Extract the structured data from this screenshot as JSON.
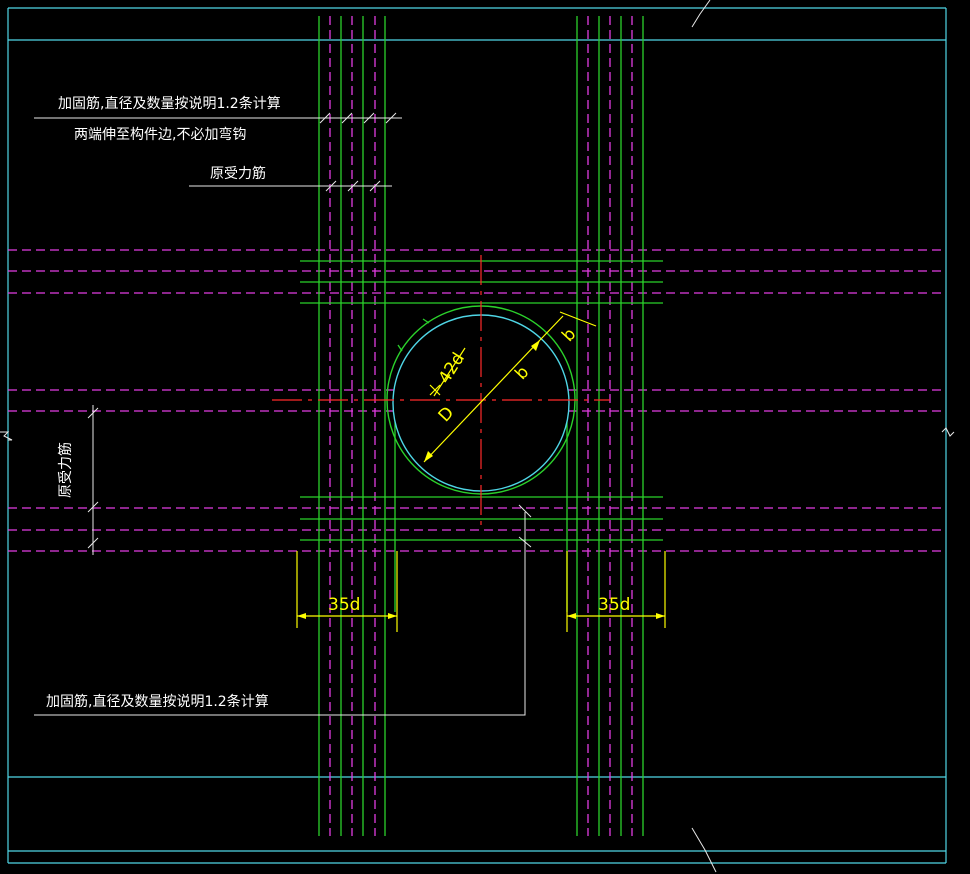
{
  "annotations": {
    "top_note_line1": "加固筋,直径及数量按说明1.2条计算",
    "top_note_line2": "两端伸至构件边,不必加弯钩",
    "original_rebar_top": "原受力筋",
    "original_rebar_left": "原受力筋",
    "bottom_note": "加固筋,直径及数量按说明1.2条计算"
  },
  "dimensions": {
    "left_span": "35d",
    "right_span": "35d",
    "hole_diameter": "D",
    "radius_label": "42d",
    "offset_label_inner": "b",
    "offset_label_outer": "b"
  },
  "colors": {
    "background": "#000000",
    "slab_edge": "#4fd6e6",
    "reinforcement": "#2bd12b",
    "original_bars": "#e23ce2",
    "centerline": "#ff2a2a",
    "dimension": "#ffff00",
    "text": "#ffffff"
  }
}
